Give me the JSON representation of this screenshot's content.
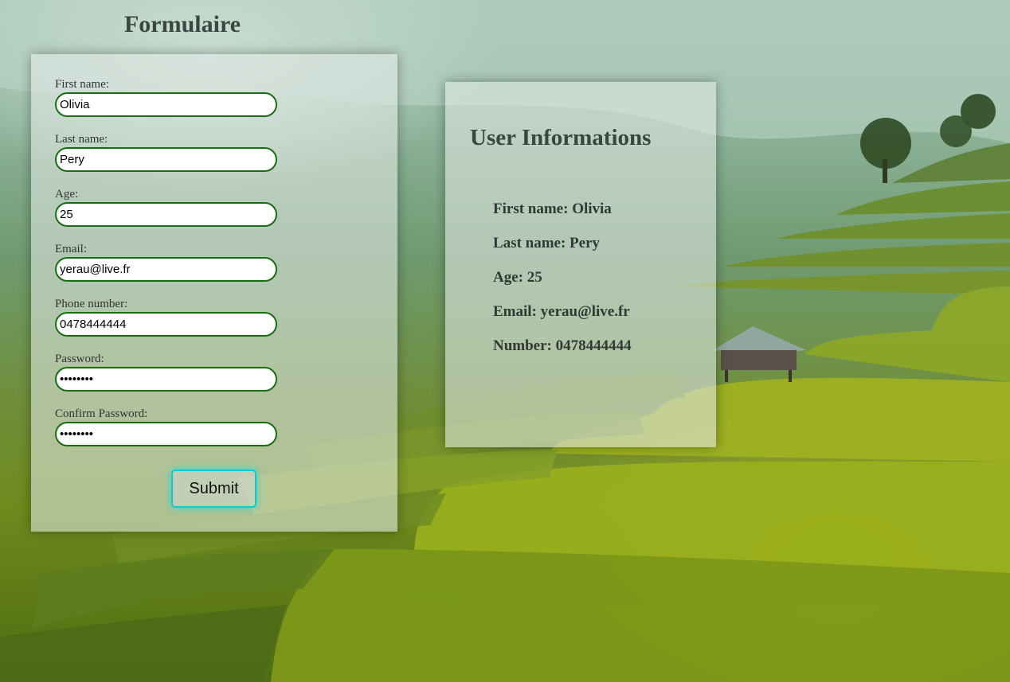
{
  "form": {
    "title": "Formulaire",
    "fields": [
      {
        "label": "First name:",
        "value": "Olivia",
        "type": "text"
      },
      {
        "label": "Last name:",
        "value": "Pery",
        "type": "text"
      },
      {
        "label": "Age:",
        "value": "25",
        "type": "text"
      },
      {
        "label": "Email:",
        "value": "yerau@live.fr",
        "type": "text"
      },
      {
        "label": "Phone number:",
        "value": "0478444444",
        "type": "text"
      },
      {
        "label": "Password:",
        "value": "••••••••",
        "type": "text"
      },
      {
        "label": "Confirm Password:",
        "value": "••••••••",
        "type": "text"
      }
    ],
    "submit_label": "Submit"
  },
  "info": {
    "title": "User Informations",
    "rows": [
      "First name: Olivia",
      "Last name: Pery",
      "Age: 25",
      "Email: yerau@live.fr",
      "Number: 0478444444"
    ]
  },
  "colors": {
    "input_border": "#1a6e12",
    "button_border": "#13c9cf",
    "heading_text": "#3b4641"
  },
  "background": {
    "description_icon": "rice-terrace-landscape-image"
  }
}
